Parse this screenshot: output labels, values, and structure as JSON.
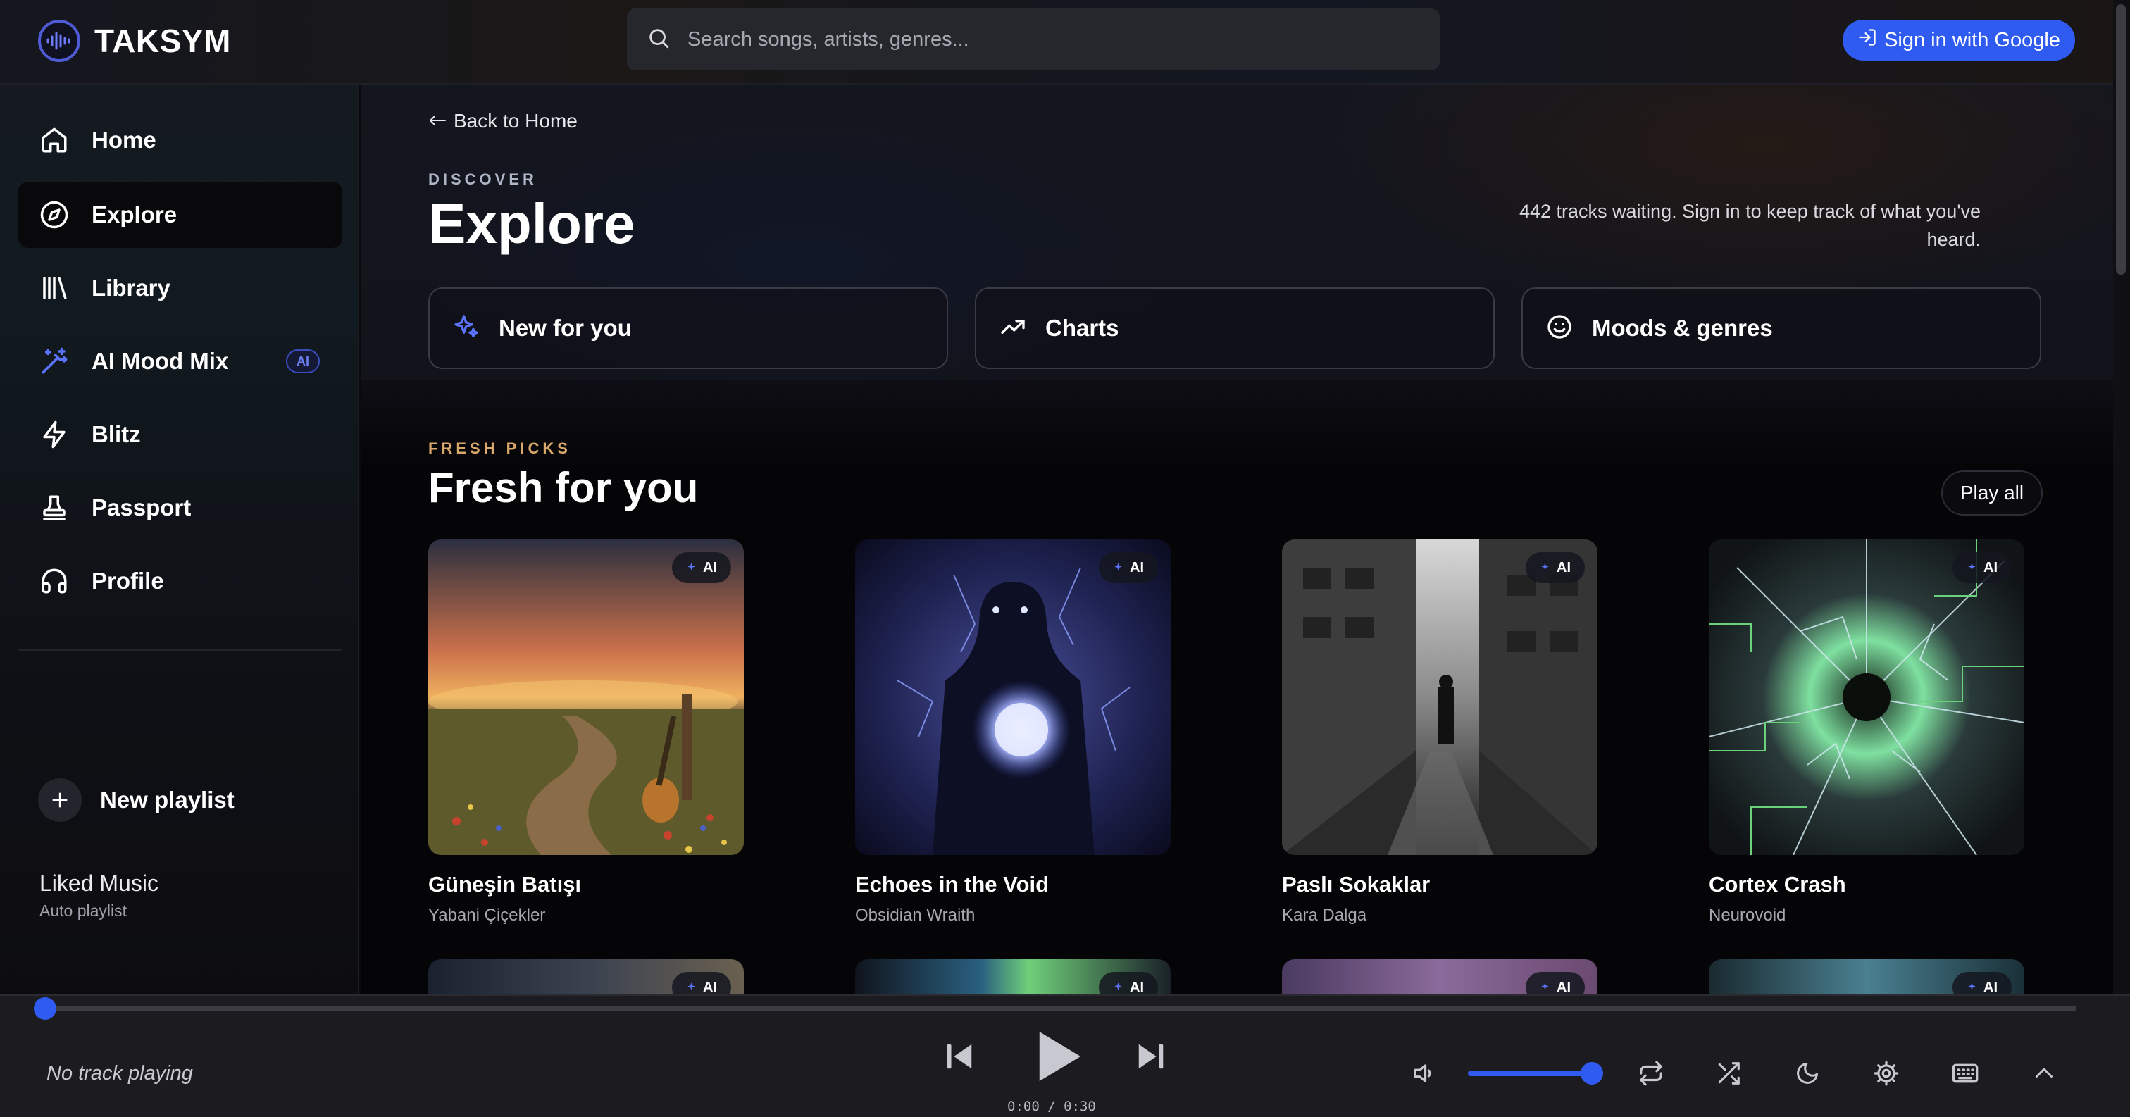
{
  "app": {
    "name": "TAKSYM"
  },
  "search": {
    "placeholder": "Search songs, artists, genres..."
  },
  "auth": {
    "signin_label": "Sign in with Google"
  },
  "sidebar": {
    "items": [
      {
        "label": "Home",
        "icon": "home-icon"
      },
      {
        "label": "Explore",
        "icon": "compass-icon",
        "active": true
      },
      {
        "label": "Library",
        "icon": "library-icon"
      },
      {
        "label": "AI Mood Mix",
        "icon": "magic-wand-icon",
        "badge": "AI"
      },
      {
        "label": "Blitz",
        "icon": "lightning-icon"
      },
      {
        "label": "Passport",
        "icon": "stamp-icon"
      },
      {
        "label": "Profile",
        "icon": "headphones-icon"
      }
    ],
    "new_playlist_label": "New playlist",
    "playlists": [
      {
        "title": "Liked Music",
        "subtitle": "Auto playlist"
      }
    ]
  },
  "main": {
    "back_label": "Back to Home",
    "eyebrow": "DISCOVER",
    "title": "Explore",
    "note": "442 tracks waiting. Sign in to keep track of what you've heard.",
    "tiles": [
      {
        "label": "New for you",
        "icon": "sparkle-icon"
      },
      {
        "label": "Charts",
        "icon": "trending-up-icon"
      },
      {
        "label": "Moods & genres",
        "icon": "smile-icon"
      }
    ],
    "section": {
      "eyebrow": "FRESH PICKS",
      "title": "Fresh for you",
      "play_all_label": "Play all",
      "badge": "AI",
      "cards": [
        {
          "title": "Güneşin Batışı",
          "artist": "Yabani Çiçekler"
        },
        {
          "title": "Echoes in the Void",
          "artist": "Obsidian Wraith"
        },
        {
          "title": "Paslı Sokaklar",
          "artist": "Kara Dalga"
        },
        {
          "title": "Cortex Crash",
          "artist": "Neurovoid"
        }
      ]
    }
  },
  "player": {
    "now_playing": "No track playing",
    "time": "0:00 / 0:30",
    "progress": 0,
    "volume": 1.0
  },
  "colors": {
    "accent": "#2f5bf0",
    "eyebrow_gold": "#d9a86a"
  }
}
